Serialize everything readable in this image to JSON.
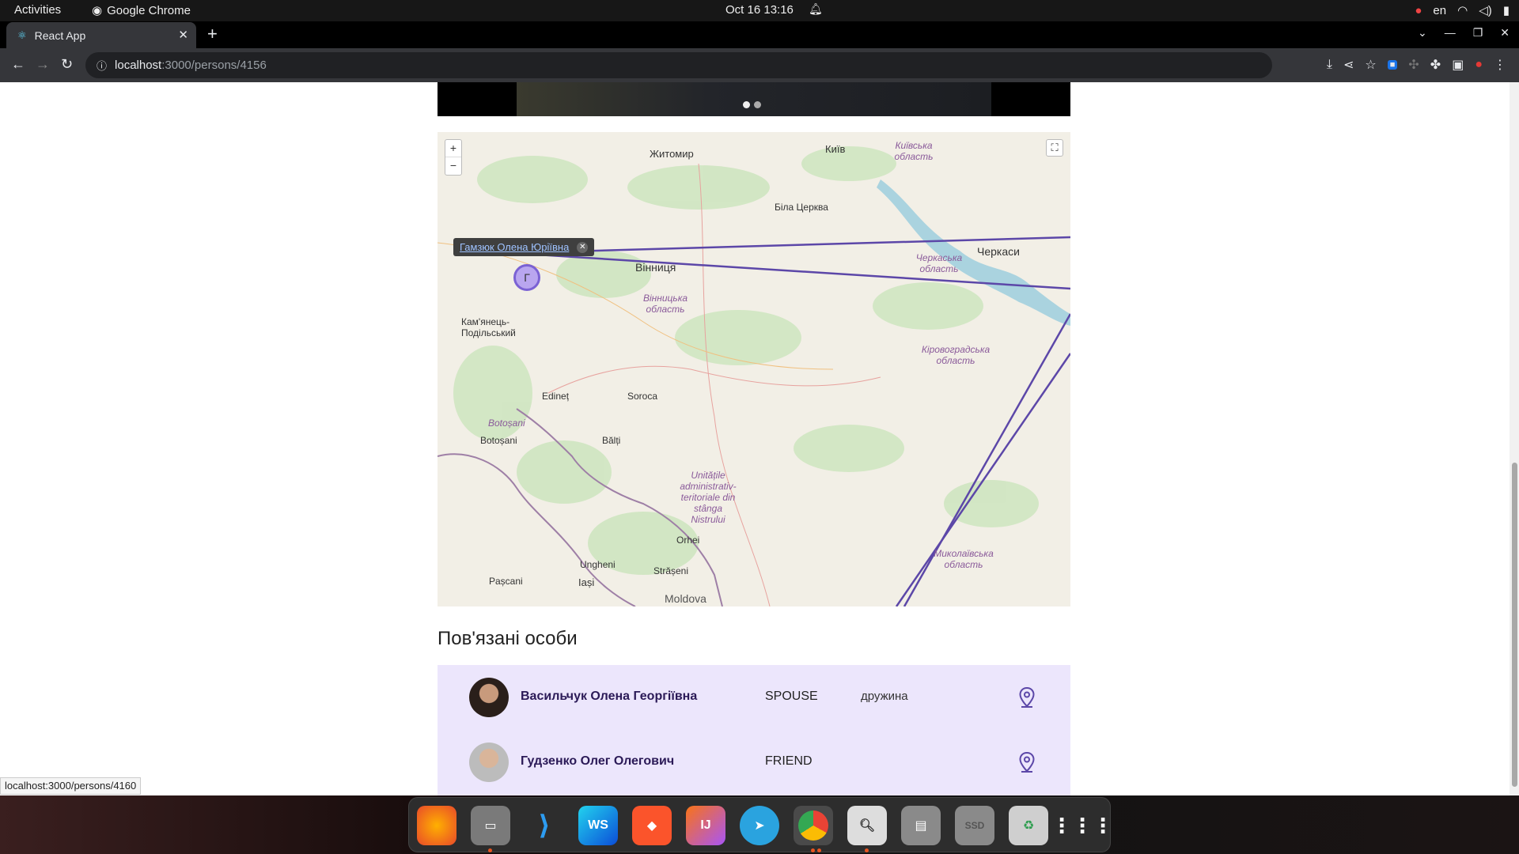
{
  "os": {
    "activities": "Activities",
    "app_name": "Google Chrome",
    "clock": "Oct 16  13:16",
    "lang": "en"
  },
  "browser": {
    "tab_title": "React App",
    "url_host": "localhost",
    "url_path": ":3000/persons/4156",
    "status_url": "localhost:3000/persons/4160"
  },
  "map": {
    "popup_label": "Гамзюк Олена Юріївна",
    "marker_letter": "Г",
    "zoom_in": "+",
    "zoom_out": "−",
    "cities": [
      {
        "name": "Житомир"
      },
      {
        "name": "Київ"
      },
      {
        "name": "Біла Церква"
      },
      {
        "name": "Вінниця"
      },
      {
        "name": "Черкаси"
      },
      {
        "name": "Кам'янець-Подільський"
      },
      {
        "name": "Edineț"
      },
      {
        "name": "Soroca"
      },
      {
        "name": "Botoșani"
      },
      {
        "name": "Bălți"
      },
      {
        "name": "Orhei"
      },
      {
        "name": "Ungheni"
      },
      {
        "name": "Pașcani"
      },
      {
        "name": "Iași"
      },
      {
        "name": "Strășeni"
      },
      {
        "name": "Moldova"
      }
    ],
    "regions": [
      {
        "name": "Київська область"
      },
      {
        "name": "Черкаська область"
      },
      {
        "name": "Вінницька область"
      },
      {
        "name": "Кіровоградська область"
      },
      {
        "name": "Миколаївська область"
      },
      {
        "name": "Unitățile administrativ-teritoriale din stânga Nistrului"
      }
    ]
  },
  "related": {
    "title": "Пов'язані особи",
    "people": [
      {
        "name": "Васильчук Олена Георгіївна",
        "relation": "SPOUSE",
        "description": "дружина"
      },
      {
        "name": "Гудзенко Олег Олегович",
        "relation": "FRIEND",
        "description": ""
      }
    ]
  },
  "dock": {
    "apps": [
      "firefox-icon",
      "files-icon",
      "vscode-icon",
      "webstorm-icon",
      "brave-icon",
      "intellij-icon",
      "telegram-icon",
      "chrome-icon",
      "image-viewer-icon",
      "disk-icon",
      "ssd-icon",
      "trash-icon",
      "app-grid-icon"
    ]
  }
}
